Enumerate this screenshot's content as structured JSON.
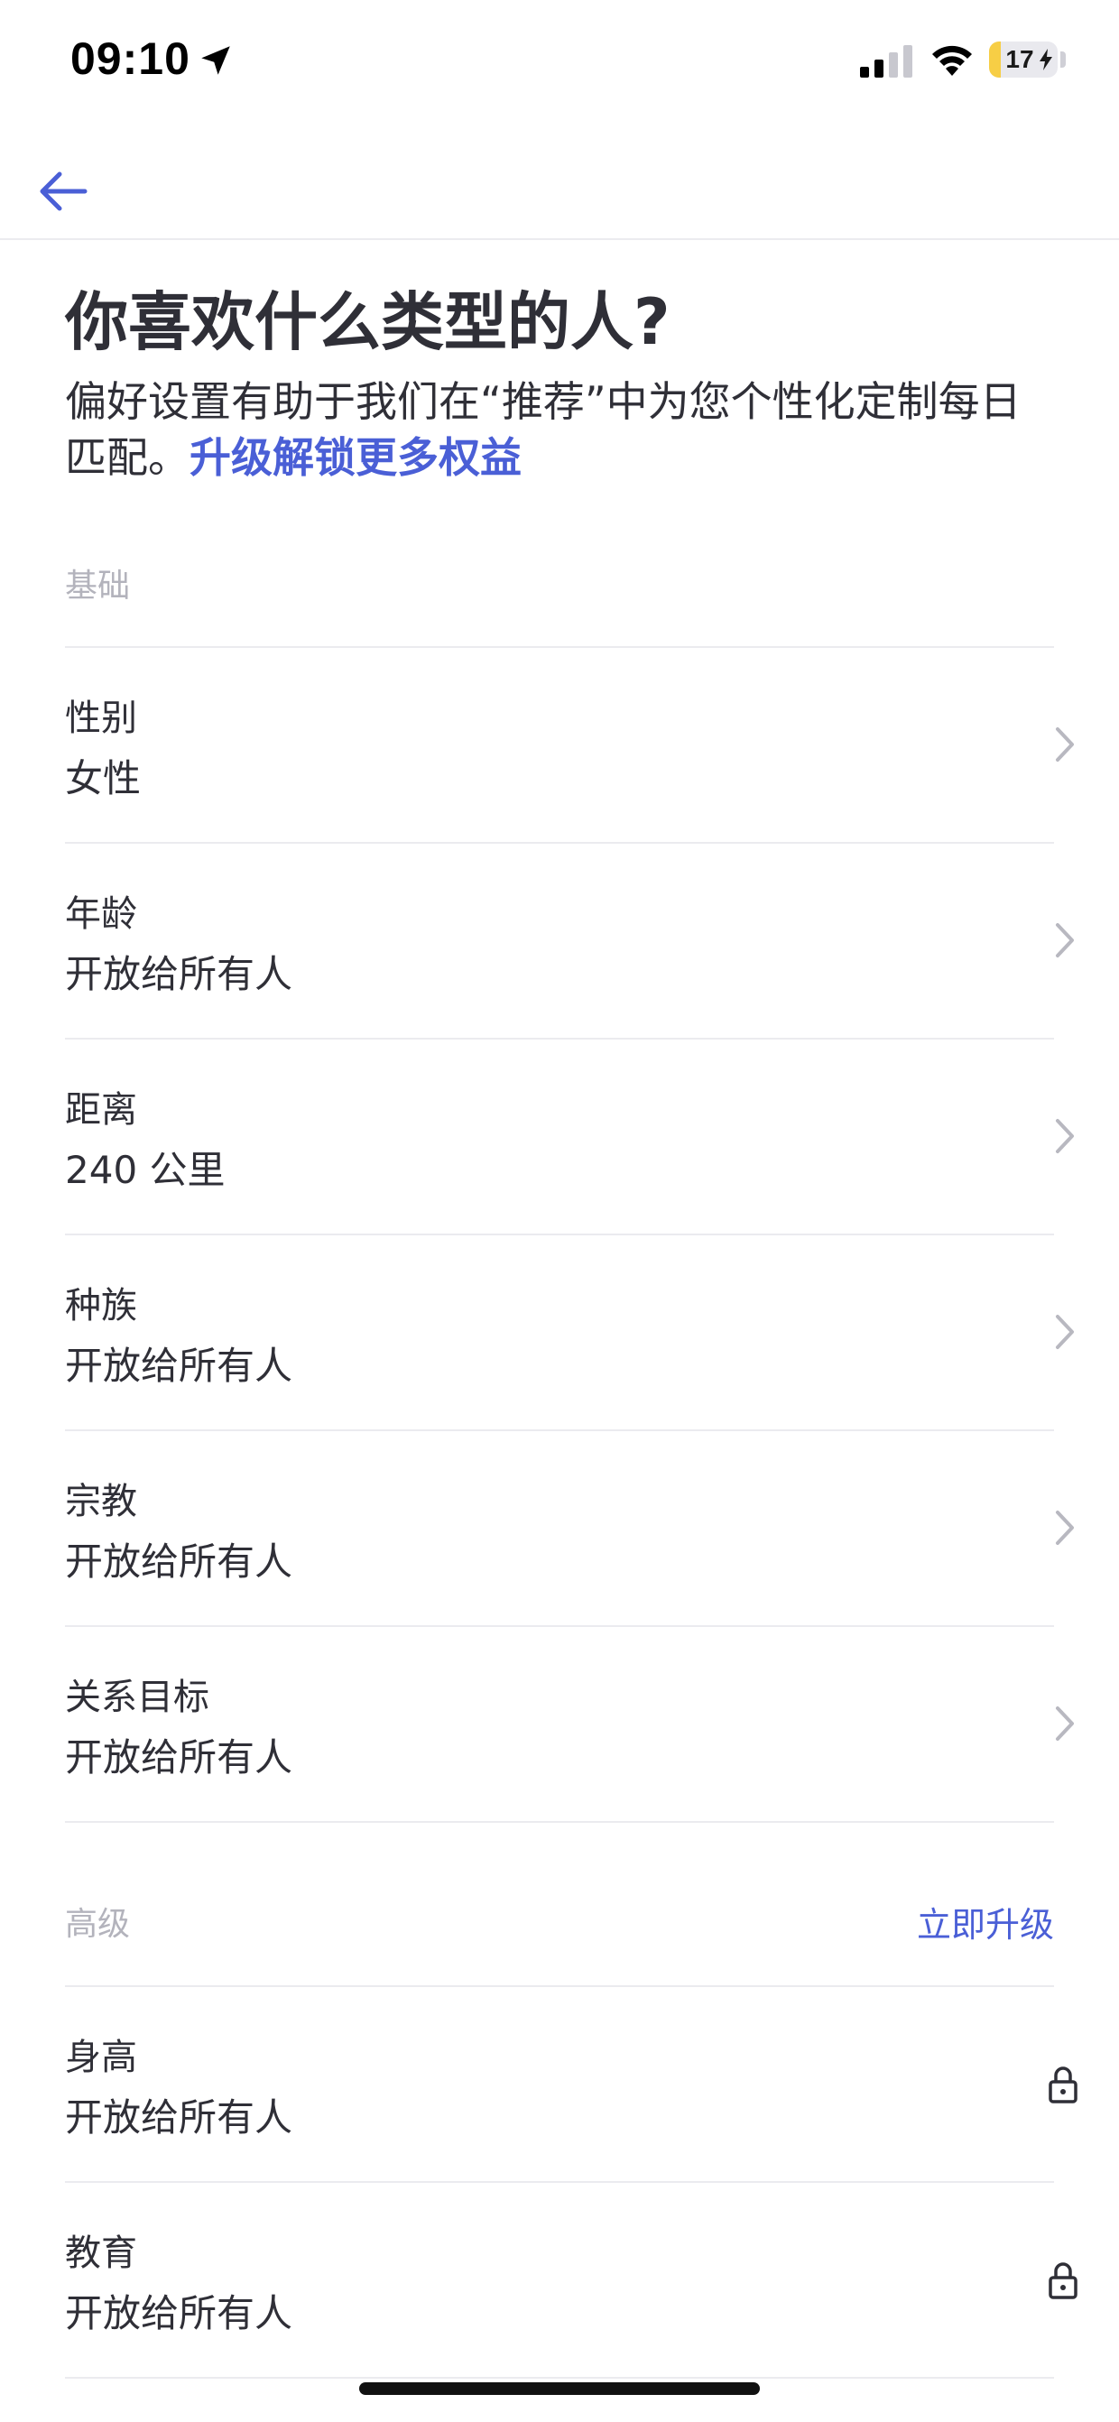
{
  "status_bar": {
    "time": "09:10",
    "battery": "17",
    "battery_level": 0.17
  },
  "header": {
    "title": "你喜欢什么类型的人?",
    "subtitle": "偏好设置有助于我们在“推荐”中为您个性化定制每日匹配。",
    "upgrade_link": "升级解锁更多权益"
  },
  "sections": {
    "basic": {
      "label": "基础",
      "rows": [
        {
          "label": "性别",
          "value": "女性"
        },
        {
          "label": "年龄",
          "value": "开放给所有人"
        },
        {
          "label": "距离",
          "value": "240 公里"
        },
        {
          "label": "种族",
          "value": "开放给所有人"
        },
        {
          "label": "宗教",
          "value": "开放给所有人"
        },
        {
          "label": "关系目标",
          "value": "开放给所有人"
        }
      ]
    },
    "advanced": {
      "label": "高级",
      "action": "立即升级",
      "rows": [
        {
          "label": "身高",
          "value": "开放给所有人"
        },
        {
          "label": "教育",
          "value": "开放给所有人"
        }
      ]
    }
  },
  "colors": {
    "accent": "#4a5fd6",
    "text": "#2f2f37",
    "muted": "#b3b3bc",
    "divider": "#ebebef",
    "battery": "#f7ce45"
  },
  "icons": {
    "back": "arrow-left-icon",
    "chevron": "chevron-right-icon",
    "lock": "lock-icon"
  }
}
